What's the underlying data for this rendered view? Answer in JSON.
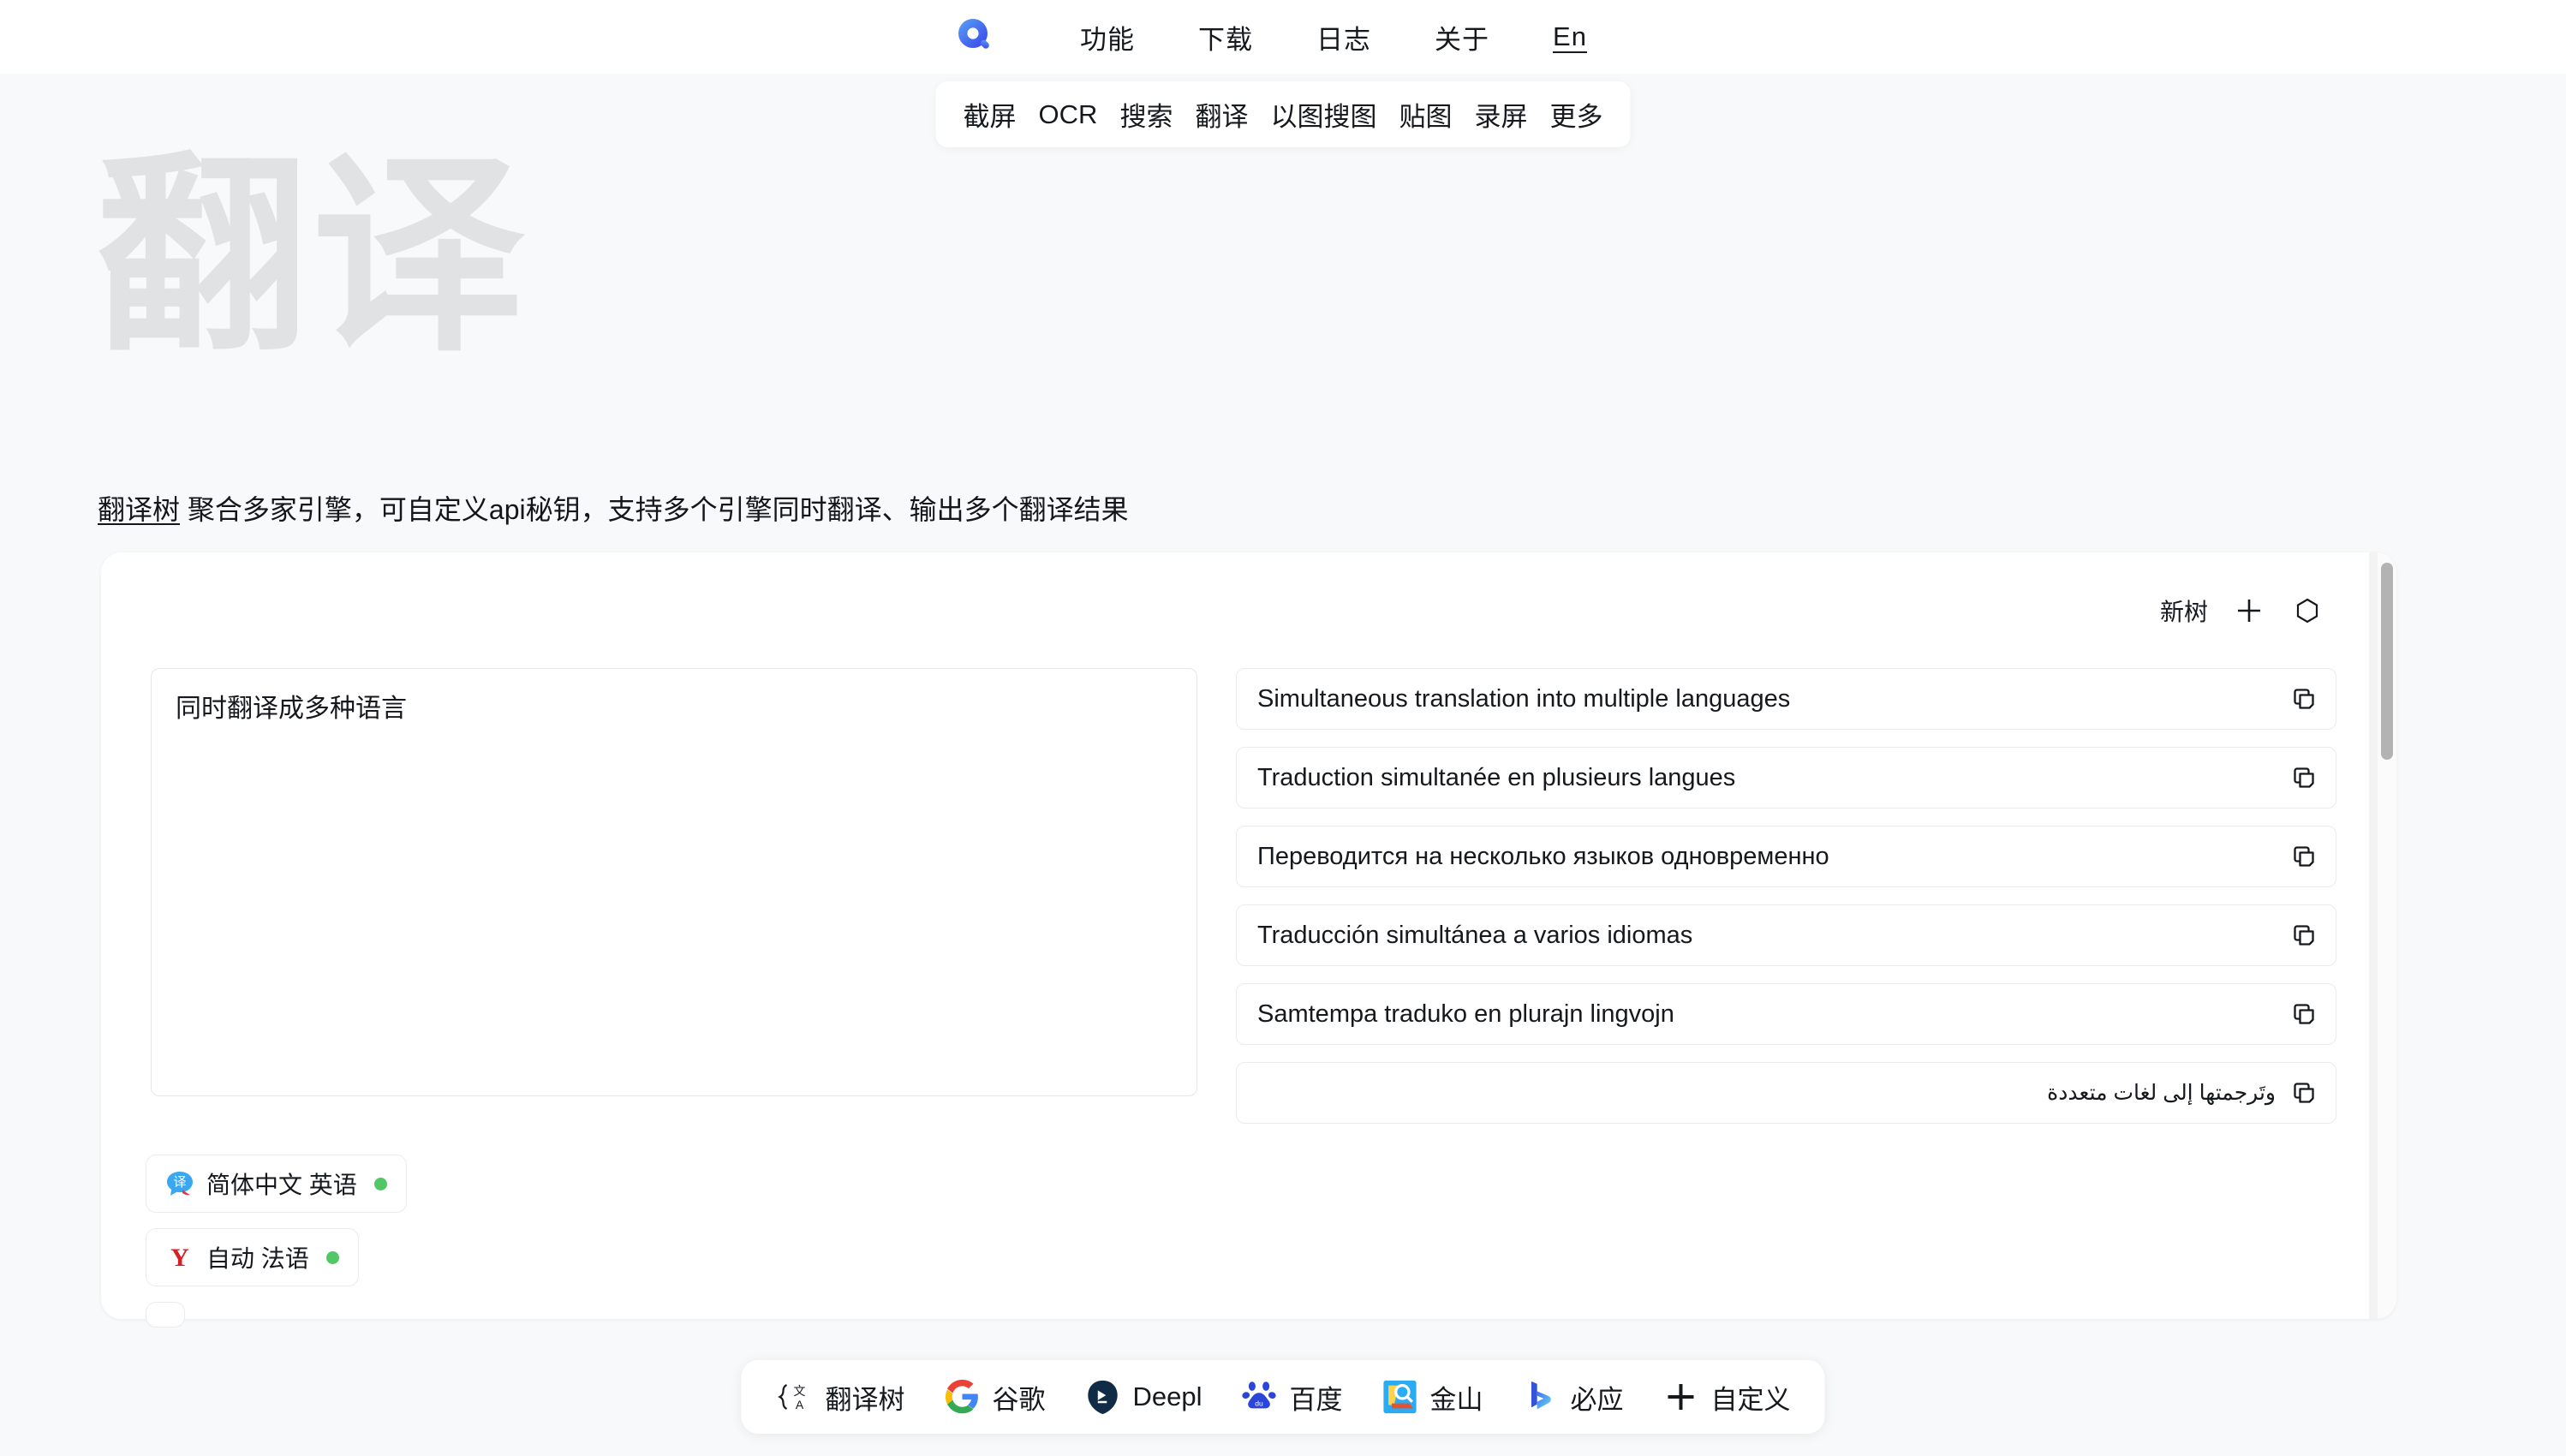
{
  "nav": {
    "logo_icon": "q-search-logo-icon",
    "links": [
      {
        "label": "功能",
        "name": "nav-features"
      },
      {
        "label": "下载",
        "name": "nav-download"
      },
      {
        "label": "日志",
        "name": "nav-changelog"
      },
      {
        "label": "关于",
        "name": "nav-about"
      }
    ],
    "language": "En"
  },
  "subnav": {
    "items": [
      "截屏",
      "OCR",
      "搜索",
      "翻译",
      "以图搜图",
      "贴图",
      "录屏",
      "更多"
    ]
  },
  "hero": {
    "watermark": "翻译",
    "brand": "翻译树",
    "description": " 聚合多家引擎，可自定义api秘钥，支持多个引擎同时翻译、输出多个翻译结果"
  },
  "card": {
    "toolbar": {
      "new_tree_label": "新树",
      "add_icon": "plus-icon",
      "hex_icon": "hexagon-icon"
    },
    "input": {
      "value": "同时翻译成多种语言",
      "placeholder": "同时翻译成多种语言"
    },
    "outputs": [
      {
        "text": "Simultaneous translation into multiple languages",
        "rtl": false
      },
      {
        "text": "Traduction simultanée en plusieurs langues",
        "rtl": false
      },
      {
        "text": "Переводится на несколько языков одновременно",
        "rtl": false
      },
      {
        "text": "Traducción simultánea a varios idiomas",
        "rtl": false
      },
      {
        "text": "Samtempa traduko en plurajn lingvojn",
        "rtl": false
      },
      {
        "text": "وتَرجمتها إلى لغات متعددة",
        "rtl": true
      }
    ],
    "copy_icon": "copy-icon",
    "chips": [
      {
        "icon": "fanyi-bubble-icon",
        "label": "简体中文 英语",
        "status": "active"
      },
      {
        "icon": "yandex-y-icon",
        "label": "自动 法语",
        "status": "active"
      }
    ]
  },
  "engines": [
    {
      "label": "翻译树",
      "icon": "fanyishu-icon"
    },
    {
      "label": "谷歌",
      "icon": "google-icon"
    },
    {
      "label": "Deepl",
      "icon": "deepl-icon"
    },
    {
      "label": "百度",
      "icon": "baidu-icon"
    },
    {
      "label": "金山",
      "icon": "jinshan-icon"
    },
    {
      "label": "必应",
      "icon": "bing-icon"
    },
    {
      "label": "自定义",
      "icon": "plus-icon"
    }
  ],
  "colors": {
    "page_bg": "#f8f9fa",
    "accent_blue": "#3b6ef6",
    "status_green": "#52c765",
    "watermark_gray": "#e1e2e4",
    "text": "#15181c"
  }
}
